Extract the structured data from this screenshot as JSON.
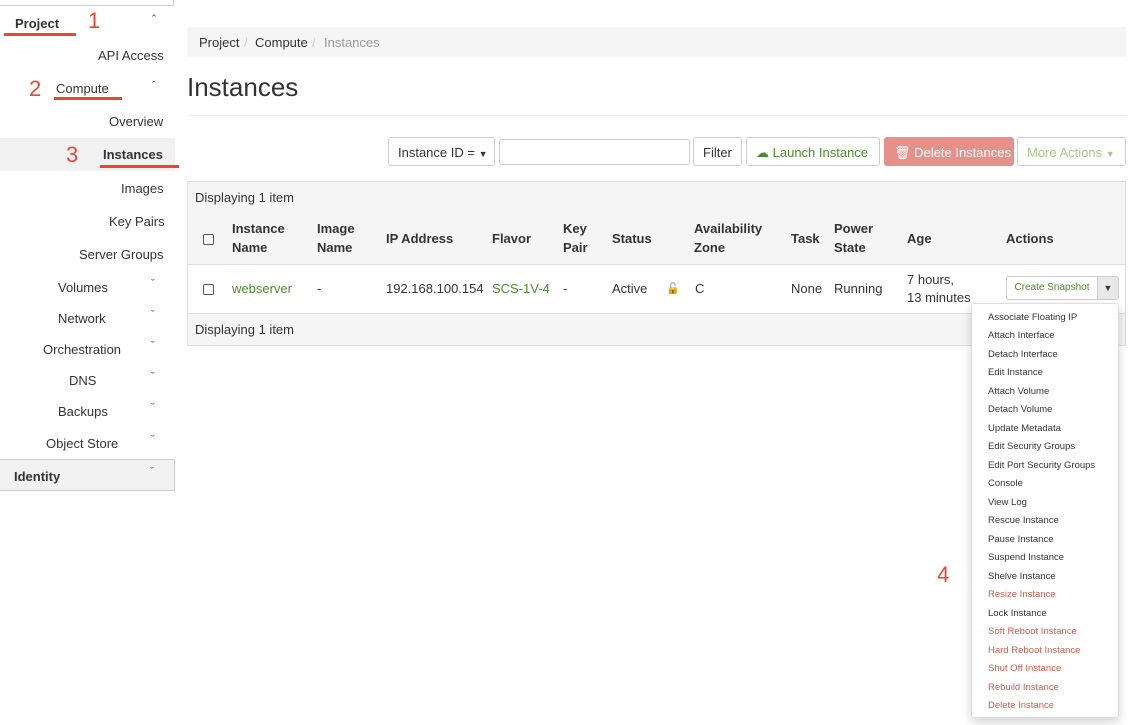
{
  "sidebar": {
    "project_label": "Project",
    "api_access": "API Access",
    "compute_label": "Compute",
    "overview": "Overview",
    "instances": "Instances",
    "images": "Images",
    "key_pairs": "Key Pairs",
    "server_groups": "Server Groups",
    "volumes": "Volumes",
    "network": "Network",
    "orchestration": "Orchestration",
    "dns": "DNS",
    "backups": "Backups",
    "object_store": "Object Store",
    "identity": "Identity"
  },
  "annotations": {
    "n1": "1",
    "n2": "2",
    "n3": "3",
    "n4": "4",
    "accent": "#e8482e"
  },
  "breadcrumb": {
    "project": "Project",
    "compute": "Compute",
    "instances": "Instances",
    "sep": "/"
  },
  "page_title": "Instances",
  "toolbar": {
    "filter_select": "Instance ID =",
    "search_value": "",
    "filter_button": "Filter",
    "launch_button": "Launch Instance",
    "delete_button": "Delete Instances",
    "more_actions": "More Actions"
  },
  "table": {
    "displaying": "Displaying 1 item",
    "headers": {
      "instance_name": [
        "Instance",
        "Name"
      ],
      "image_name": [
        "Image",
        "Name"
      ],
      "ip_address": "IP Address",
      "flavor": "Flavor",
      "key_pair": [
        "Key",
        "Pair"
      ],
      "status": "Status",
      "availability_zone": [
        "Availability",
        "Zone"
      ],
      "task": "Task",
      "power_state": [
        "Power",
        "State"
      ],
      "age": "Age",
      "actions": "Actions"
    },
    "row": {
      "instance_name": "webserver",
      "image_name": "-",
      "ip_address": "192.168.100.154",
      "flavor": "SCS-1V-4",
      "key_pair": "-",
      "status": "Active",
      "availability_zone": "C",
      "task": "None",
      "power_state": "Running",
      "age_line1": "7 hours,",
      "age_line2": "13 minutes",
      "action_button": "Create Snapshot"
    }
  },
  "dropdown": {
    "items": [
      "Associate Floating IP",
      "Attach Interface",
      "Detach Interface",
      "Edit Instance",
      "Attach Volume",
      "Detach Volume",
      "Update Metadata",
      "Edit Security Groups",
      "Edit Port Security Groups",
      "Console",
      "View Log",
      "Rescue Instance",
      "Pause Instance",
      "Suspend Instance",
      "Shelve Instance",
      "Resize Instance",
      "Lock Instance",
      "Soft Reboot Instance",
      "Hard Reboot Instance",
      "Shut Off Instance",
      "Rebuild Instance",
      "Delete Instance"
    ]
  }
}
